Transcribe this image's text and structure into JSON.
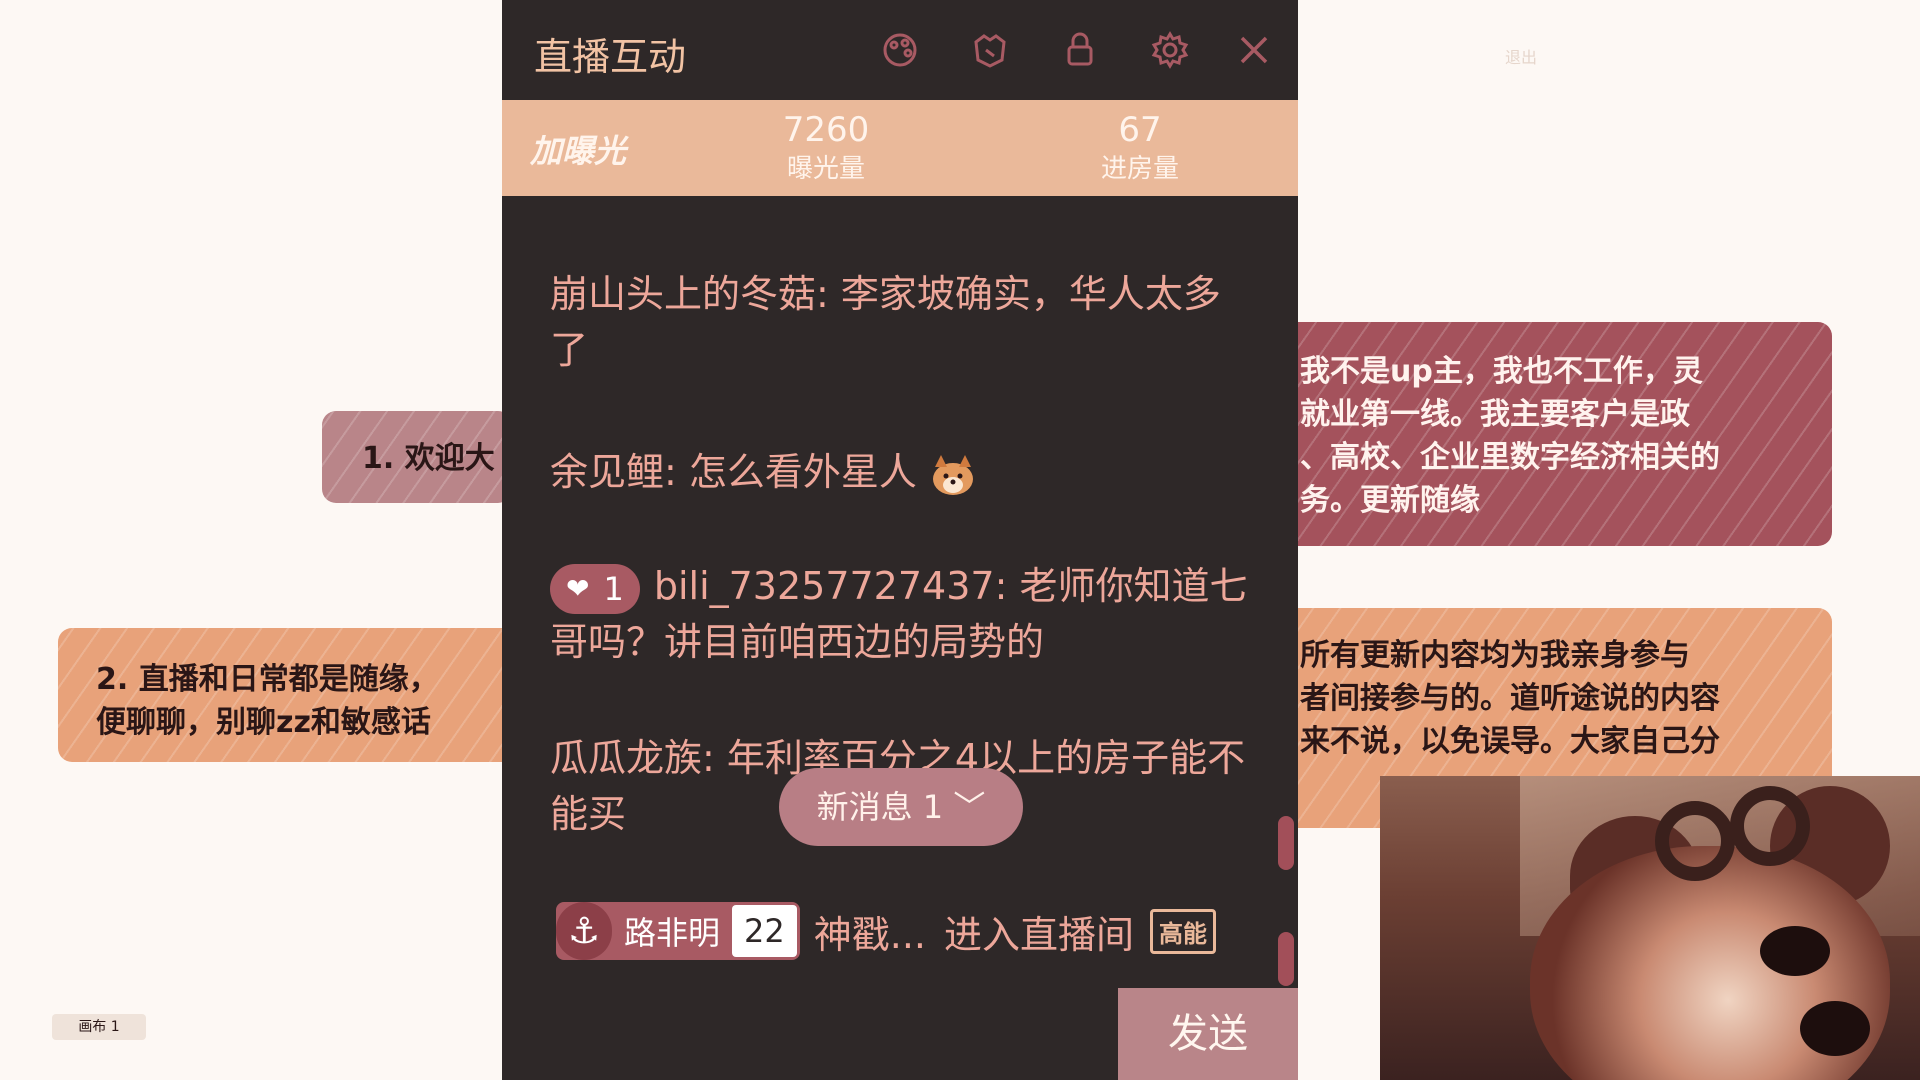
{
  "canvas": {
    "cards": [
      {
        "text": "1. 欢迎大"
      },
      {
        "text": "2. 直播和日常都是随缘，\n便聊聊，别聊zz和敏感话"
      },
      {
        "text": "我不是up主，我也不工作，灵\n就业第一线。我主要客户是政\n、高校、企业里数字经济相关的\n务。更新随缘"
      },
      {
        "text": "所有更新内容均为我亲身参与\n者间接参与的。道听途说的内容\n来不说，以免误导。大家自己分"
      }
    ],
    "tab_label": "画布 1",
    "toolbar_text": "退出"
  },
  "panel": {
    "title": "直播互动",
    "icons": [
      "paint-icon",
      "nameplate-icon",
      "lock-icon",
      "settings-icon",
      "close-icon"
    ],
    "boost": "加曝光",
    "stats": [
      {
        "value": "7260",
        "label": "曝光量"
      },
      {
        "value": "67",
        "label": "进房量"
      }
    ],
    "messages": [
      {
        "user": "崩山头上的冬菇",
        "text": "李家坡确实，华人太多了"
      },
      {
        "user": "余见鲤",
        "text": "怎么看外星人",
        "emoji": "dog-face-emoji"
      },
      {
        "badge_level": "1",
        "user": "bili_73257727437",
        "text": "老师你知道七哥吗？讲目前咱西边的局势的"
      },
      {
        "user": "瓜瓜龙族",
        "text": "年利率百分之4以上的房子能不能买"
      }
    ],
    "new_message": "新消息 1",
    "enter": {
      "badge_name": "路非明",
      "badge_level": "22",
      "user": "神戳...",
      "action": "进入直播间",
      "tag": "高能"
    },
    "input_placeholder": "",
    "send": "发送"
  },
  "colors": {
    "panel_bg": "#2e2828",
    "accent": "#eab99a",
    "message_text": "#eda79a",
    "badge": "#a85a63"
  }
}
